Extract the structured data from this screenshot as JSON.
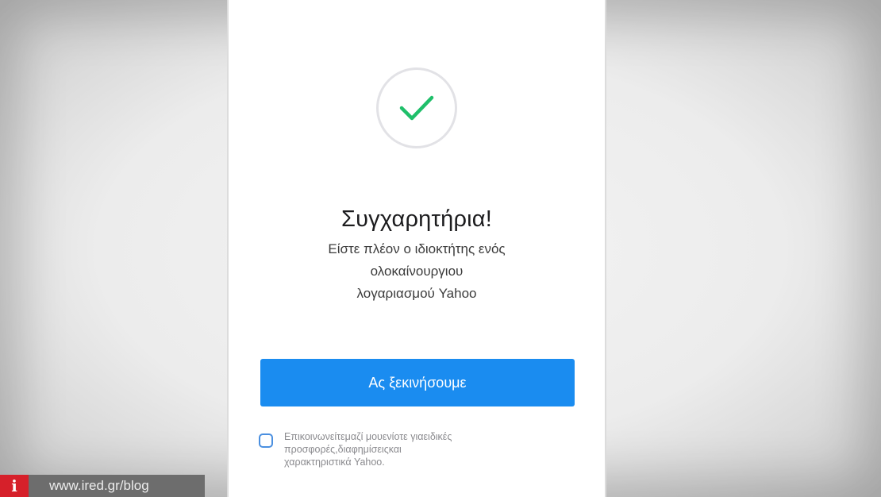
{
  "success": {
    "icon": "check-icon",
    "title": "Συγχαρητήρια!",
    "message_lines": [
      "Είστε πλέον ο ιδιοκτήτης ενός",
      "ολοκαίνουργιου",
      "λογαριασμού Yahoo"
    ]
  },
  "cta": {
    "label": "Ας ξεκινήσουμε"
  },
  "optin": {
    "checked": false,
    "text_lines": [
      "Επικοινωνείτεμαζί μουενίοτε γιαειδικές",
      "προσφορές,διαφημίσειςκαι",
      "χαρακτηριστικά Yahoo."
    ]
  },
  "watermark": {
    "logo": "i",
    "text": "www.ired.gr/blog"
  },
  "colors": {
    "accent": "#1a8cf0",
    "check": "#1fbf6a",
    "watermark_red": "#d6202a"
  }
}
